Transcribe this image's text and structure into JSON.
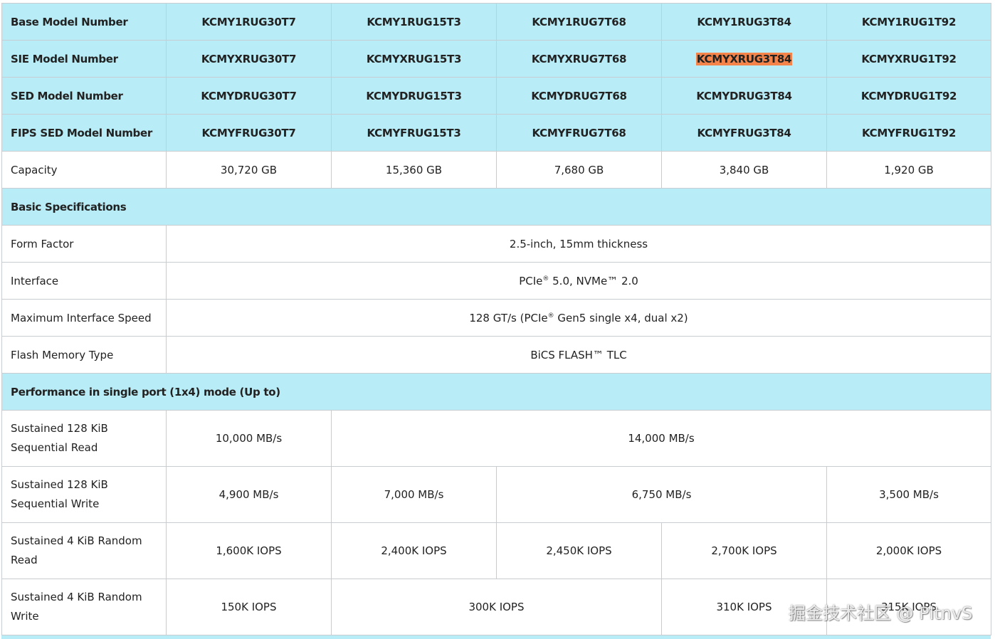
{
  "models": {
    "base": {
      "label": "Base Model Number",
      "values": [
        "KCMY1RUG30T7",
        "KCMY1RUG15T3",
        "KCMY1RUG7T68",
        "KCMY1RUG3T84",
        "KCMY1RUG1T92"
      ]
    },
    "sie": {
      "label": "SIE Model Number",
      "values": [
        "KCMYXRUG30T7",
        "KCMYXRUG15T3",
        "KCMYXRUG7T68",
        "KCMYXRUG3T84",
        "KCMYXRUG1T92"
      ],
      "highlighted_index": 3,
      "highlight_color": "#f5844b"
    },
    "sed": {
      "label": "SED Model Number",
      "values": [
        "KCMYDRUG30T7",
        "KCMYDRUG15T3",
        "KCMYDRUG7T68",
        "KCMYDRUG3T84",
        "KCMYDRUG1T92"
      ]
    },
    "fips": {
      "label": "FIPS SED Model Number",
      "values": [
        "KCMYFRUG30T7",
        "KCMYFRUG15T3",
        "KCMYFRUG7T68",
        "KCMYFRUG3T84",
        "KCMYFRUG1T92"
      ]
    }
  },
  "capacity": {
    "label": "Capacity",
    "values": [
      "30,720 GB",
      "15,360 GB",
      "7,680 GB",
      "3,840 GB",
      "1,920 GB"
    ]
  },
  "basic_specs": {
    "heading": "Basic Specifications",
    "form_factor": {
      "label": "Form Factor",
      "value": "2.5-inch, 15mm thickness"
    },
    "interface": {
      "label": "Interface",
      "value_a": "PCIe",
      "reg": "®",
      "value_b": " 5.0, NVMe™ 2.0"
    },
    "max_speed": {
      "label": "Maximum Interface Speed",
      "value_a": "128 GT/s (PCIe",
      "reg": "®",
      "value_b": " Gen5 single x4, dual x2)"
    },
    "flash": {
      "label": "Flash Memory Type",
      "value": "BiCS FLASH™ TLC"
    }
  },
  "performance": {
    "heading": "Performance in single port (1x4) mode (Up to)",
    "seq_read": {
      "label": "Sustained 128 KiB Sequential Read",
      "values": [
        "10,000 MB/s",
        "14,000 MB/s"
      ]
    },
    "seq_write": {
      "label": "Sustained 128 KiB Sequential Write",
      "values": [
        "4,900 MB/s",
        "7,000 MB/s",
        "6,750 MB/s",
        "3,500 MB/s"
      ]
    },
    "rand_read": {
      "label": "Sustained 4 KiB Random Read",
      "values": [
        "1,600K IOPS",
        "2,400K IOPS",
        "2,450K IOPS",
        "2,700K IOPS",
        "2,000K IOPS"
      ]
    },
    "rand_write": {
      "label": "Sustained 4 KiB Random Write",
      "values": [
        "150K IOPS",
        "300K IOPS",
        "310K IOPS",
        "315K IOPS"
      ]
    }
  },
  "watermark": "掘金技术社区 @ PltnvS",
  "colors": {
    "header_bg": "#b8ecf6",
    "border": "#c8cdd2",
    "highlight": "#f5844b"
  }
}
